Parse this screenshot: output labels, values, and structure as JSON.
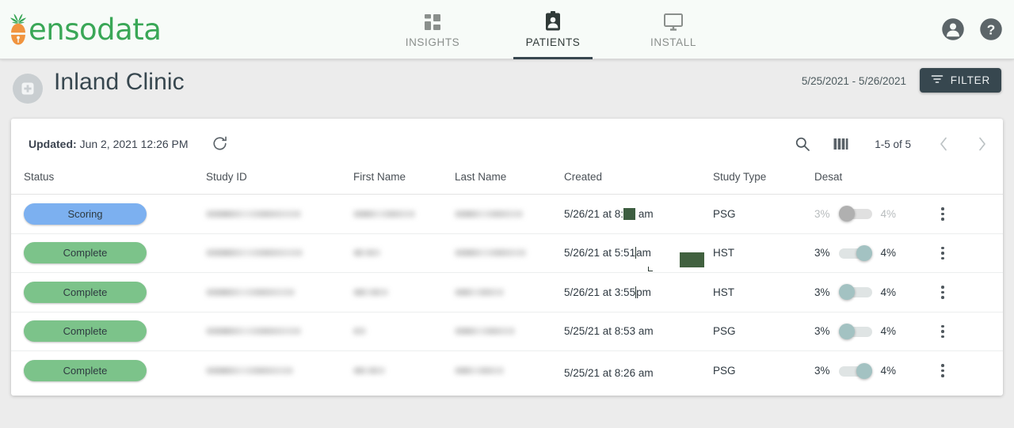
{
  "brand": {
    "name": "ensodata",
    "logo_icon": "pineapple-logo",
    "color": "#3aa757"
  },
  "nav": {
    "items": [
      {
        "label": "INSIGHTS",
        "icon": "dashboard-grid-icon",
        "active": false
      },
      {
        "label": "PATIENTS",
        "icon": "patient-badge-icon",
        "active": true
      },
      {
        "label": "INSTALL",
        "icon": "monitor-icon",
        "active": false
      }
    ],
    "account_icon": "account-circle-icon",
    "help_icon": "help-circle-icon"
  },
  "page": {
    "title": "Inland Clinic",
    "avatar_icon": "clinic-building-icon",
    "date_range": "5/25/2021 - 5/26/2021",
    "filter_label": "FILTER",
    "filter_icon": "filter-funnel-icon"
  },
  "toolbar": {
    "updated_label": "Updated:",
    "updated_value": "Jun 2, 2021 12:26 PM",
    "refresh_icon": "refresh-icon",
    "search_icon": "search-icon",
    "columns_icon": "columns-icon",
    "pagination_label": "1-5 of 5",
    "prev_icon": "chevron-left-icon",
    "next_icon": "chevron-right-icon"
  },
  "table": {
    "columns": [
      "Status",
      "Study ID",
      "First Name",
      "Last Name",
      "Created",
      "Study Type",
      "Desat"
    ],
    "menu_icon": "more-vertical-icon",
    "desat_low": "3%",
    "desat_high": "4%",
    "rows": [
      {
        "status": "Scoring",
        "status_color": "#7cb0f0",
        "study_id": "",
        "first_name": "",
        "last_name": "",
        "created": "5/26/21 at 8:21 am",
        "study_type": "PSG",
        "toggle": "off",
        "toggle_disabled": true
      },
      {
        "status": "Complete",
        "status_color": "#7cc38a",
        "study_id": "",
        "first_name": "",
        "last_name": "",
        "created": "5/26/21 at 5:51 am",
        "study_type": "HST",
        "toggle": "on",
        "toggle_disabled": false
      },
      {
        "status": "Complete",
        "status_color": "#7cc38a",
        "study_id": "",
        "first_name": "",
        "last_name": "",
        "created": "5/26/21 at 3:55 pm",
        "study_type": "HST",
        "toggle": "off",
        "toggle_disabled": false
      },
      {
        "status": "Complete",
        "status_color": "#7cc38a",
        "study_id": "",
        "first_name": "",
        "last_name": "",
        "created": "5/25/21 at 8:53 am",
        "study_type": "PSG",
        "toggle": "off",
        "toggle_disabled": false
      },
      {
        "status": "Complete",
        "status_color": "#7cc38a",
        "study_id": "",
        "first_name": "",
        "last_name": "",
        "created": "5/25/21 at 8:26 am",
        "study_type": "PSG",
        "toggle": "on",
        "toggle_disabled": false
      }
    ]
  }
}
